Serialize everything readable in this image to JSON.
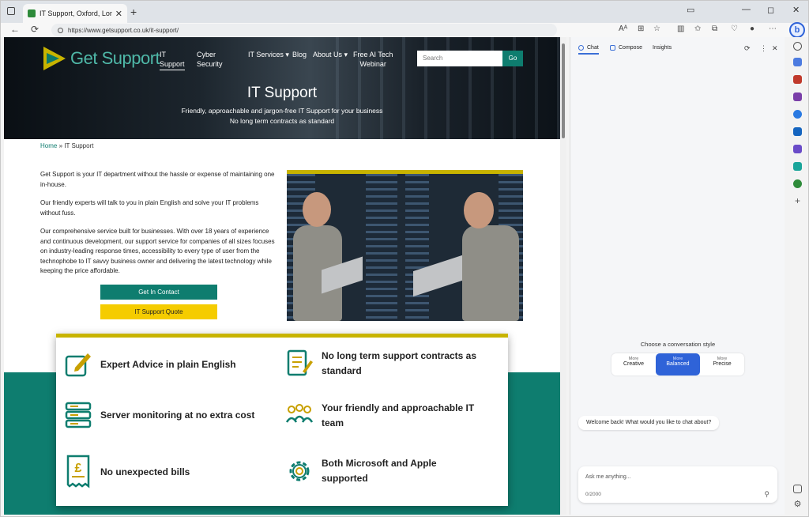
{
  "browser": {
    "tab_title": "IT Support, Oxford, London & R...",
    "tab_close": "✕",
    "new_tab": "+",
    "url": "https://www.getsupport.co.uk/it-support/",
    "minimize": "—",
    "maximize": "◻",
    "close": "✕",
    "back": "←",
    "refresh": "⟳"
  },
  "site": {
    "logo_text": "Get Support",
    "nav": [
      "IT",
      "Support",
      "Cyber",
      "Security",
      "IT Services ▾",
      "Blog",
      "About Us ▾",
      "Free AI Tech",
      "Webinar"
    ],
    "search_placeholder": "Search",
    "go_label": "Go",
    "hero_title": "IT Support",
    "hero_sub1": "Friendly, approachable and jargon-free IT Support for your business",
    "hero_sub2": "No long term contracts as standard",
    "breadcrumb_home": "Home",
    "breadcrumb_sep": " » ",
    "breadcrumb_current": "IT Support",
    "paragraphs": [
      "Get Support is your IT department without the hassle or expense of maintaining one in-house.",
      "Our friendly experts will talk to you in plain English and solve your IT problems without fuss.",
      "Our comprehensive service built for businesses. With over 18 years of experience and continuous development, our support service for companies of all sizes focuses on industry-leading response times, accessibility to every type of user from the technophobe to IT savvy business owner and delivering the latest technology while keeping the price affordable."
    ],
    "btn_contact": "Get In Contact",
    "btn_quote": "IT Support Quote",
    "features": [
      "Expert Advice in plain English",
      "No long term support contracts as standard",
      "Server monitoring at no extra cost",
      "Your friendly and approachable IT team",
      "No unexpected bills",
      "Both Microsoft and Apple supported"
    ]
  },
  "copilot": {
    "tabs": [
      "Chat",
      "Compose",
      "Insights"
    ],
    "style_label": "Choose a conversation style",
    "styles": [
      {
        "more": "More",
        "name": "Creative"
      },
      {
        "more": "More",
        "name": "Balanced"
      },
      {
        "more": "More",
        "name": "Precise"
      }
    ],
    "welcome": "Welcome back! What would you like to chat about?",
    "ask_placeholder": "Ask me anything...",
    "char_count": "0/2000"
  },
  "colors": {
    "teal": "#0e7d6f",
    "yellow": "#f5cc00",
    "gold_bar": "#c8b400",
    "copilot_blue": "#2f63d8"
  }
}
